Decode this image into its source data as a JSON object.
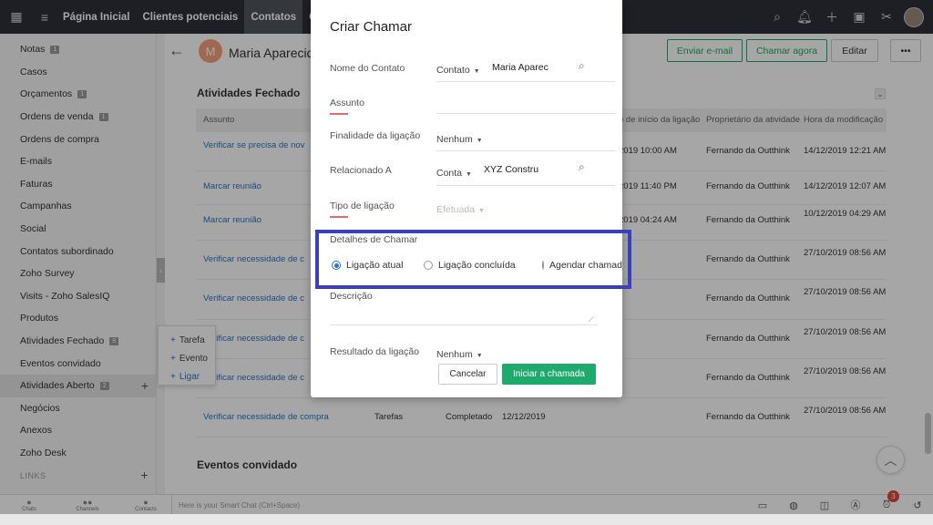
{
  "topbar": {
    "nav": [
      "Página Inicial",
      "Clientes potenciais",
      "Contatos",
      "Conta"
    ],
    "active_index": 2,
    "icons": [
      "search-icon",
      "bell-icon",
      "plus-icon",
      "calendar-icon",
      "tools-icon",
      "user-avatar"
    ]
  },
  "sidebar": {
    "items": [
      {
        "label": "Notas",
        "badge": "1"
      },
      {
        "label": "Casos"
      },
      {
        "label": "Orçamentos",
        "badge": "1"
      },
      {
        "label": "Ordens de venda",
        "badge": "1"
      },
      {
        "label": "Ordens de compra"
      },
      {
        "label": "E-mails"
      },
      {
        "label": "Faturas"
      },
      {
        "label": "Campanhas"
      },
      {
        "label": "Social"
      },
      {
        "label": "Contatos subordinado"
      },
      {
        "label": "Zoho Survey"
      },
      {
        "label": "Visits - Zoho SalesIQ"
      },
      {
        "label": "Produtos"
      },
      {
        "label": "Atividades Fechado",
        "badge": "8"
      },
      {
        "label": "Eventos convidado"
      },
      {
        "label": "Atividades Aberto",
        "badge": "2"
      },
      {
        "label": "Negócios"
      },
      {
        "label": "Anexos"
      },
      {
        "label": "Zoho Desk"
      }
    ],
    "links_label": "LINKS"
  },
  "popup_menu": {
    "items": [
      "Tarefa",
      "Evento",
      "Ligar"
    ]
  },
  "header": {
    "avatar_letter": "M",
    "contact_name": "Maria Aparecida",
    "send_email": "Enviar e-mail",
    "call_now": "Chamar agora",
    "edit": "Editar",
    "more": "•••"
  },
  "closed_activities": {
    "title": "Atividades Fechado",
    "columns": [
      "Assunto",
      "o de início da ligação",
      "Proprietário da atividade",
      "Hora da modificação"
    ],
    "rows": [
      {
        "subject": "Verificar se precisa de nov",
        "start": "2019 10:00 AM",
        "owner": "Fernando da Outthink",
        "modified": "14/12/2019 12:21 AM"
      },
      {
        "subject": "Marcar reunião",
        "start": "2019 11:40 PM",
        "owner": "Fernando da Outthink",
        "modified": "14/12/2019 12:07 AM"
      },
      {
        "subject": "Marcar reunião",
        "start": "2019 04:24 AM",
        "owner": "Fernando da Outthink",
        "modified": "10/12/2019 04:29 AM"
      },
      {
        "subject": "Verificar necessidade de c",
        "start": "",
        "owner": "Fernando da Outthink",
        "modified": "27/10/2019 08:56 AM"
      },
      {
        "subject": "Verificar necessidade de c",
        "start": "",
        "owner": "Fernando da Outthink",
        "modified": "27/10/2019 08:56 AM"
      },
      {
        "subject": "Verificar necessidade de c",
        "start": "",
        "owner": "Fernando da Outthink",
        "modified": "27/10/2019 08:56 AM"
      },
      {
        "subject": "Verificar necessidade de c",
        "start": "",
        "owner": "Fernando da Outthink",
        "modified": "27/10/2019 08:56 AM"
      },
      {
        "subject": "Verificar necessidade de compra",
        "type": "Tarefas",
        "status": "Completado",
        "date": "12/12/2019",
        "owner": "Fernando da Outthink",
        "modified": "27/10/2019 08:56 AM"
      }
    ]
  },
  "invited_events": {
    "title": "Eventos convidado"
  },
  "bottombar": {
    "tabs": [
      "Chats",
      "Channels",
      "Contacts"
    ],
    "smart_chat_placeholder": "Here is your Smart Chat (Ctrl+Space)",
    "notification_count": "3"
  },
  "modal": {
    "title": "Criar Chamar",
    "contact_label": "Nome do Contato",
    "contact_type": "Contato",
    "contact_value": "Maria Aparec",
    "subject_label": "Assunto",
    "purpose_label": "Finalidade da ligação",
    "purpose_value": "Nenhum",
    "related_label": "Relacionado A",
    "related_type": "Conta",
    "related_value": "XYZ Constru",
    "calltype_label": "Tipo de ligação",
    "calltype_value": "Efetuada",
    "details_label": "Detalhes de Chamar",
    "radios": [
      "Ligação atual",
      "Ligação concluída",
      "Agendar chamada"
    ],
    "radio_selected": 0,
    "description_label": "Descrição",
    "result_label": "Resultado da ligação",
    "result_value": "Nenhum",
    "cancel": "Cancelar",
    "start": "Iniciar a chamada"
  }
}
